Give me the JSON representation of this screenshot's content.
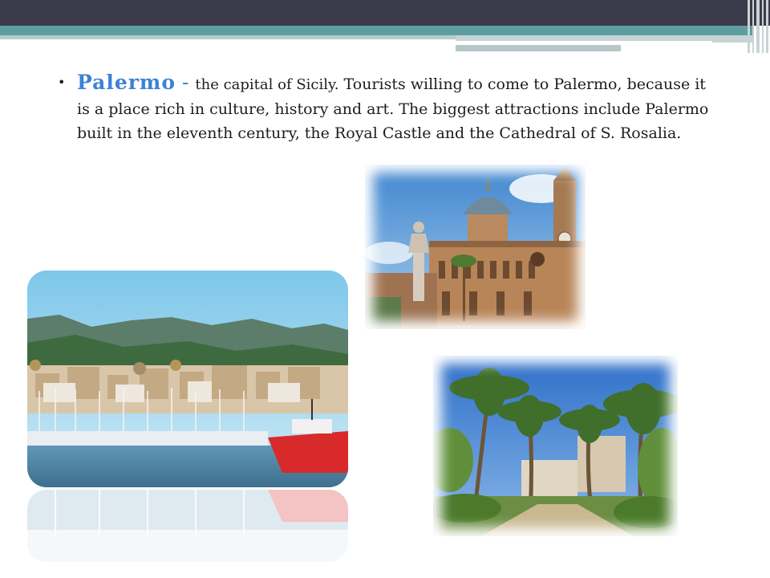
{
  "slide": {
    "city_name": "Palermo",
    "dash": " - ",
    "text_first": "the capital of Sicily.",
    "text_rest": " Tourists willing to come to Palermo, because it is a place rich in culture, history and art. The biggest attractions include Palermo built in the eleventh century, the Royal Castle and the Cathedral of S. Rosalia."
  },
  "colors": {
    "accent_blue": "#3c82d6",
    "header_dark": "#3c3b4b",
    "header_teal": "#5e9ea0"
  },
  "images": {
    "cathedral": "cathedral-photo",
    "harbor": "harbor-photo",
    "palms": "palm-garden-photo"
  }
}
